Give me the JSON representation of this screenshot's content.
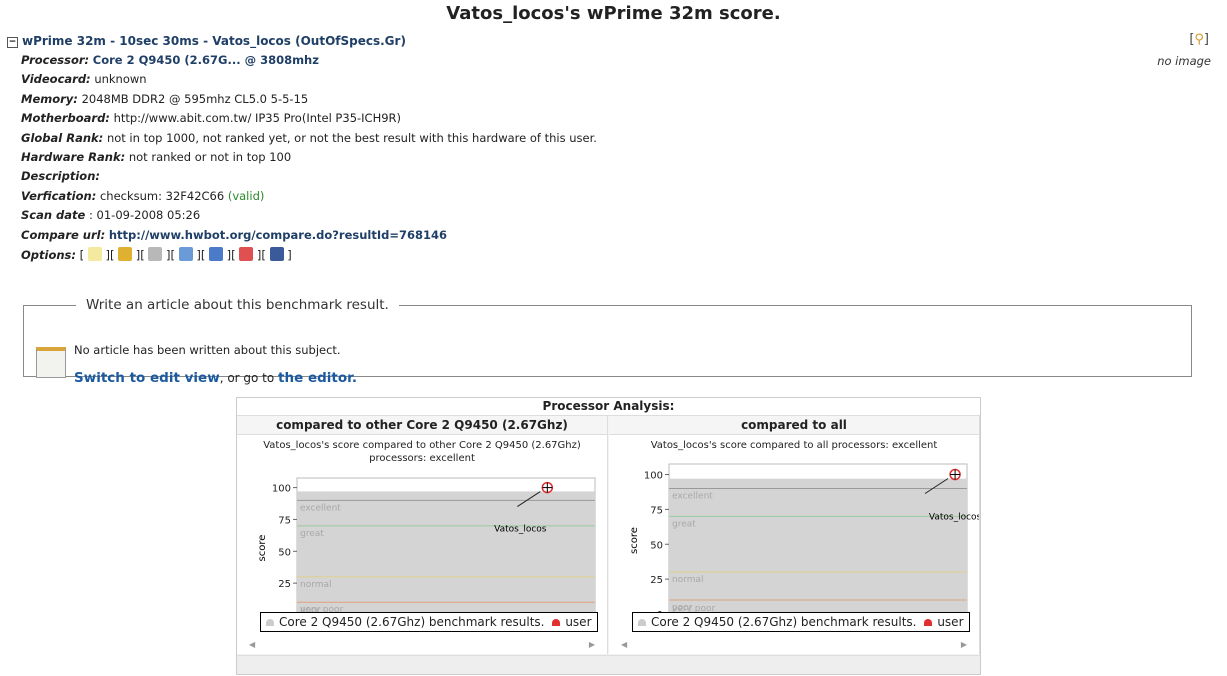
{
  "page_title": "Vatos_locos's wPrime 32m score.",
  "result_heading": "wPrime 32m - 10sec 30ms - Vatos_locos (OutOfSpecs.Gr)",
  "toggle": "−",
  "image": {
    "zoom_open": "[",
    "zoom_close": "]",
    "no_image": "no image"
  },
  "details": [
    {
      "label": "Processor:",
      "value": "Core 2 Q9450 (2.67G... @ 3808mhz",
      "style": "link"
    },
    {
      "label": "Videocard:",
      "value": "unknown"
    },
    {
      "label": "Memory:",
      "value": "2048MB DDR2 @ 595mhz CL5.0 5-5-15"
    },
    {
      "label": "Motherboard:",
      "value": "http://www.abit.com.tw/ IP35 Pro(Intel P35-ICH9R)"
    },
    {
      "label": "Global Rank:",
      "value": "not in top 1000, not ranked yet, or not the best result with this hardware of this user."
    },
    {
      "label": "Hardware Rank:",
      "value": "not ranked or not in top 100"
    },
    {
      "label": "Description:",
      "value": ""
    },
    {
      "label": "Verfication:",
      "value": "checksum: 32F42C66",
      "extra": "(valid)"
    },
    {
      "label": "Scan date",
      "value": ": 01-09-2008 05:26"
    },
    {
      "label": "Compare url:",
      "value": "http://www.hwbot.org/compare.do?resultId=768146",
      "style": "link"
    }
  ],
  "options": {
    "label": "Options:",
    "icons": [
      "edit-icon",
      "bell-icon",
      "database-icon",
      "users-icon",
      "user-icon",
      "chart-icon",
      "book-icon"
    ]
  },
  "article": {
    "legend": "Write an article about this benchmark result.",
    "none": "No article has been written about this subject.",
    "switch": "Switch to edit view",
    "middle": ", or go to ",
    "editor": "the editor."
  },
  "analysis": {
    "title": "Processor Analysis:"
  },
  "chart_data": [
    {
      "type": "area",
      "panel_title": "compared to other Core 2 Q9450 (2.67Ghz)",
      "title_line1": "Vatos_locos's score compared to other Core 2 Q9450 (2.67Ghz)",
      "title_line2": "processors: excellent",
      "ylabel": "score",
      "ylim": [
        0,
        100
      ],
      "yticks": [
        "0",
        "25",
        "50",
        "75",
        "100"
      ],
      "bands": [
        {
          "name": "excellent",
          "y": 90
        },
        {
          "name": "great",
          "y": 70
        },
        {
          "name": "normal",
          "y": 30
        },
        {
          "name": "poor",
          "y": 10
        },
        {
          "name": "very poor",
          "y": 0
        }
      ],
      "area_level": 97,
      "user": {
        "name": "Vatos_locos",
        "x": 0.84,
        "y": 100
      },
      "legend": [
        "Core 2 Q9450 (2.67Ghz) benchmark results.",
        "user"
      ]
    },
    {
      "type": "area",
      "panel_title": "compared to all",
      "title_line1": "Vatos_locos's score compared to all processors: excellent",
      "title_line2": "",
      "ylabel": "score",
      "ylim": [
        0,
        100
      ],
      "yticks": [
        "0",
        "25",
        "50",
        "75",
        "100"
      ],
      "bands": [
        {
          "name": "excellent",
          "y": 90
        },
        {
          "name": "great",
          "y": 70
        },
        {
          "name": "normal",
          "y": 30
        },
        {
          "name": "poor",
          "y": 10
        },
        {
          "name": "very poor",
          "y": 0
        }
      ],
      "area_level": 97,
      "user": {
        "name": "Vatos_locos",
        "x": 0.96,
        "y": 100
      },
      "legend": [
        "Core 2 Q9450 (2.67Ghz) benchmark results.",
        "user"
      ]
    }
  ],
  "colors": {
    "link": "#1f3f66",
    "valid": "#2a8a2a",
    "area": "#d4d4d4",
    "user": "#e03030"
  }
}
